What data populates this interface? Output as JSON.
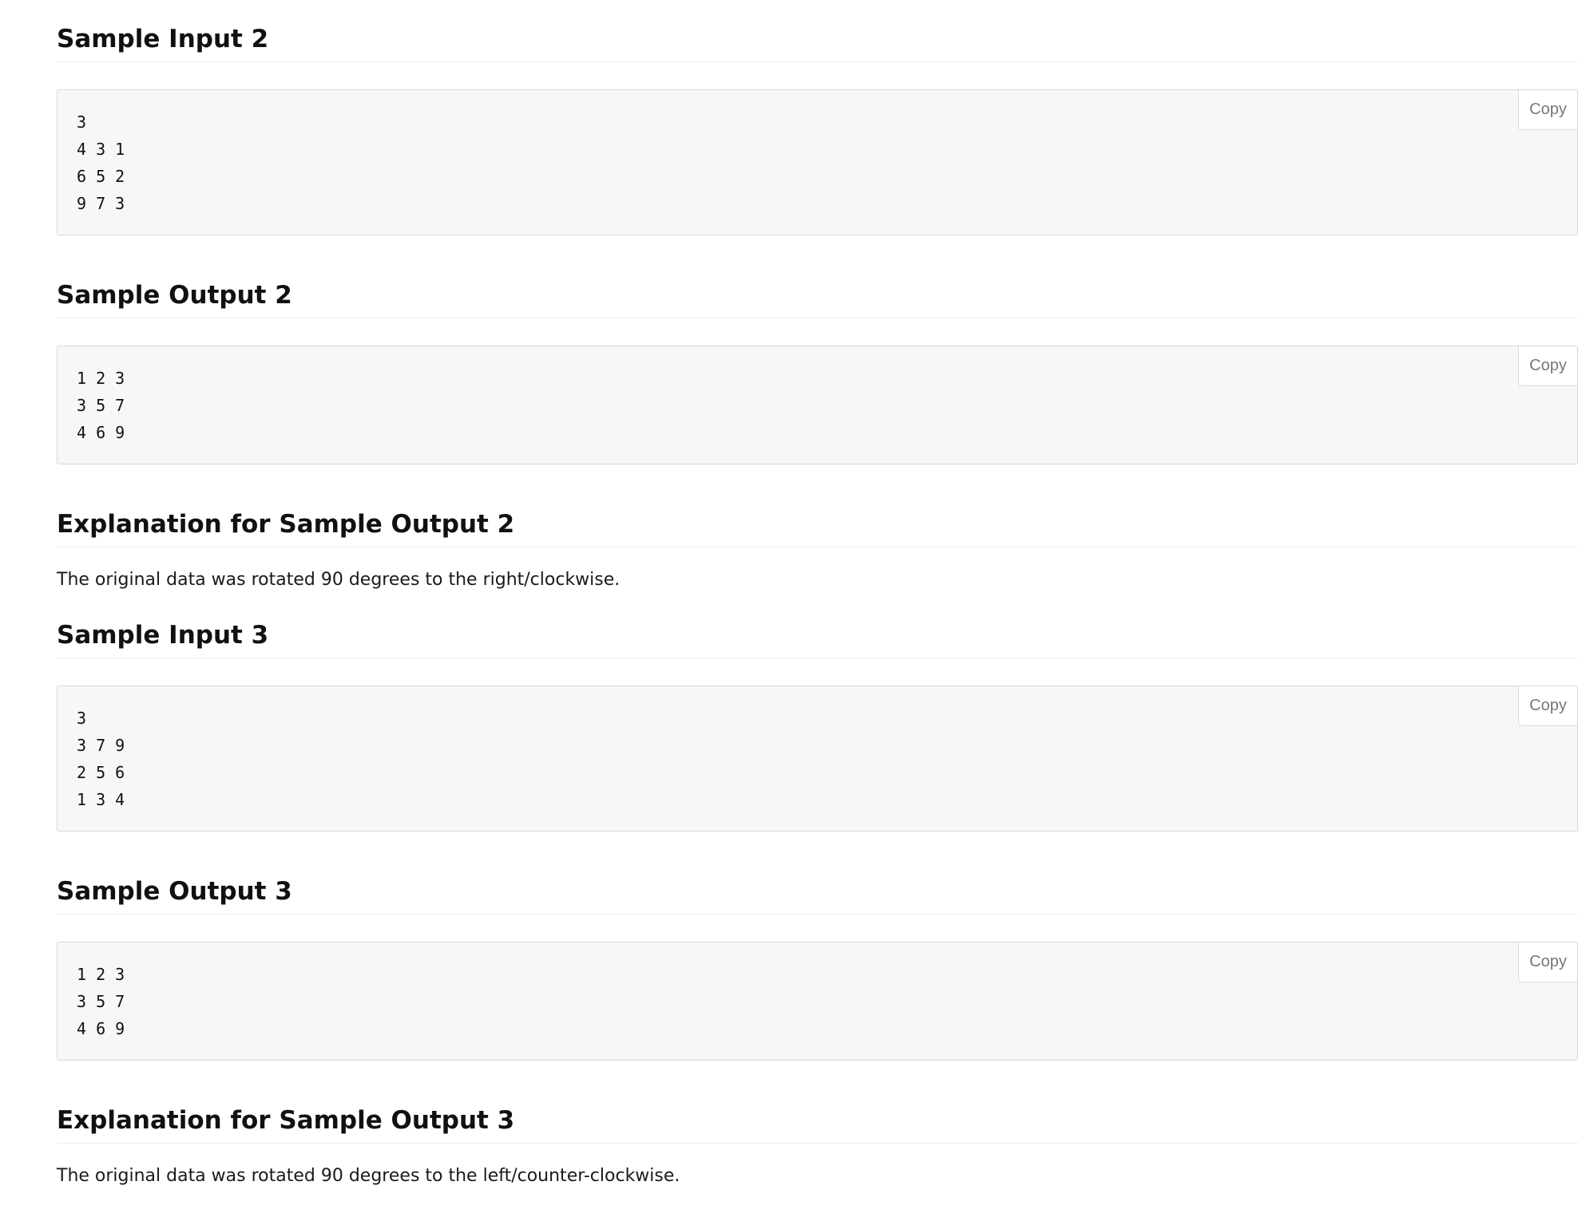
{
  "copy_label": "Copy",
  "sections": {
    "input2": {
      "title": "Sample Input 2",
      "code": "3\n4 3 1\n6 5 2\n9 7 3"
    },
    "output2": {
      "title": "Sample Output 2",
      "code": "1 2 3\n3 5 7\n4 6 9"
    },
    "explanation2": {
      "title": "Explanation for Sample Output 2",
      "text": "The original data was rotated 90 degrees to the right/clockwise."
    },
    "input3": {
      "title": "Sample Input 3",
      "code": "3\n3 7 9\n2 5 6\n1 3 4"
    },
    "output3": {
      "title": "Sample Output 3",
      "code": "1 2 3\n3 5 7\n4 6 9"
    },
    "explanation3": {
      "title": "Explanation for Sample Output 3",
      "text": "The original data was rotated 90 degrees to the left/counter-clockwise."
    }
  }
}
